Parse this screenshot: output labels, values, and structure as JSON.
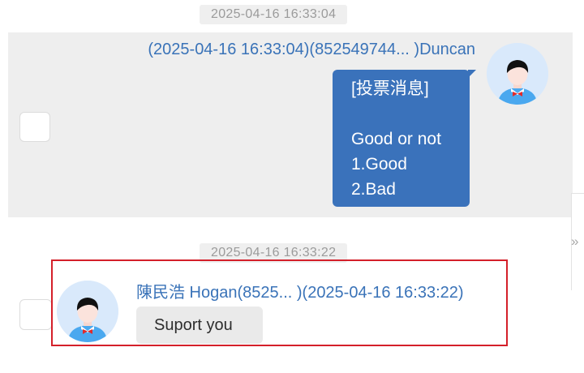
{
  "conversation": {
    "message_1": {
      "timestamp": "2025-04-16 16:33:04",
      "sender_line": "(2025-04-16 16:33:04)(852549744...  )Duncan",
      "lines": [
        "[投票消息]",
        "",
        "Good or not",
        "1.Good",
        "2.Bad"
      ]
    },
    "message_2": {
      "timestamp": "2025-04-16 16:33:22",
      "sender_line": "陳民浩 Hogan(8525...  )(2025-04-16 16:33:22)",
      "text": "Suport you"
    }
  },
  "icons": {
    "avatar": "avatar-icon",
    "expand": "double-chevron-right-icon"
  },
  "colors": {
    "outgoing_bubble": "#3a72bb",
    "sender_text": "#3a73b8",
    "highlight": "#d4202a"
  },
  "expand_glyph": "»"
}
